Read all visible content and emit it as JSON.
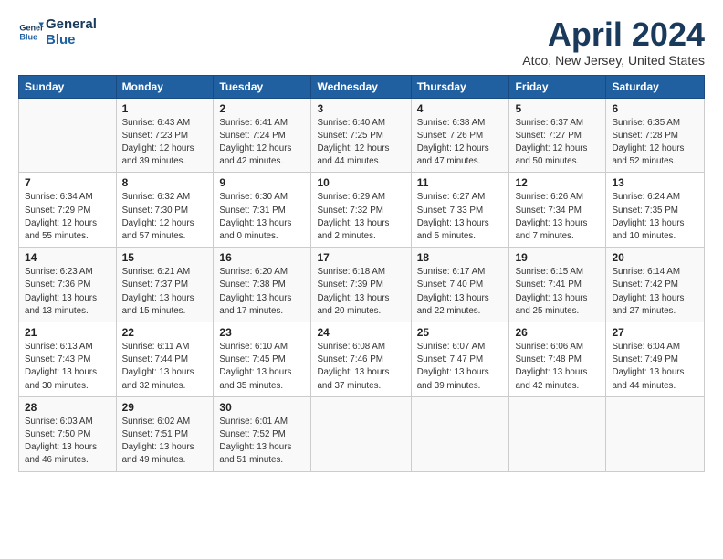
{
  "header": {
    "logo_line1": "General",
    "logo_line2": "Blue",
    "title": "April 2024",
    "subtitle": "Atco, New Jersey, United States"
  },
  "calendar": {
    "days_of_week": [
      "Sunday",
      "Monday",
      "Tuesday",
      "Wednesday",
      "Thursday",
      "Friday",
      "Saturday"
    ],
    "weeks": [
      [
        {
          "day": "",
          "info": ""
        },
        {
          "day": "1",
          "info": "Sunrise: 6:43 AM\nSunset: 7:23 PM\nDaylight: 12 hours\nand 39 minutes."
        },
        {
          "day": "2",
          "info": "Sunrise: 6:41 AM\nSunset: 7:24 PM\nDaylight: 12 hours\nand 42 minutes."
        },
        {
          "day": "3",
          "info": "Sunrise: 6:40 AM\nSunset: 7:25 PM\nDaylight: 12 hours\nand 44 minutes."
        },
        {
          "day": "4",
          "info": "Sunrise: 6:38 AM\nSunset: 7:26 PM\nDaylight: 12 hours\nand 47 minutes."
        },
        {
          "day": "5",
          "info": "Sunrise: 6:37 AM\nSunset: 7:27 PM\nDaylight: 12 hours\nand 50 minutes."
        },
        {
          "day": "6",
          "info": "Sunrise: 6:35 AM\nSunset: 7:28 PM\nDaylight: 12 hours\nand 52 minutes."
        }
      ],
      [
        {
          "day": "7",
          "info": "Sunrise: 6:34 AM\nSunset: 7:29 PM\nDaylight: 12 hours\nand 55 minutes."
        },
        {
          "day": "8",
          "info": "Sunrise: 6:32 AM\nSunset: 7:30 PM\nDaylight: 12 hours\nand 57 minutes."
        },
        {
          "day": "9",
          "info": "Sunrise: 6:30 AM\nSunset: 7:31 PM\nDaylight: 13 hours\nand 0 minutes."
        },
        {
          "day": "10",
          "info": "Sunrise: 6:29 AM\nSunset: 7:32 PM\nDaylight: 13 hours\nand 2 minutes."
        },
        {
          "day": "11",
          "info": "Sunrise: 6:27 AM\nSunset: 7:33 PM\nDaylight: 13 hours\nand 5 minutes."
        },
        {
          "day": "12",
          "info": "Sunrise: 6:26 AM\nSunset: 7:34 PM\nDaylight: 13 hours\nand 7 minutes."
        },
        {
          "day": "13",
          "info": "Sunrise: 6:24 AM\nSunset: 7:35 PM\nDaylight: 13 hours\nand 10 minutes."
        }
      ],
      [
        {
          "day": "14",
          "info": "Sunrise: 6:23 AM\nSunset: 7:36 PM\nDaylight: 13 hours\nand 13 minutes."
        },
        {
          "day": "15",
          "info": "Sunrise: 6:21 AM\nSunset: 7:37 PM\nDaylight: 13 hours\nand 15 minutes."
        },
        {
          "day": "16",
          "info": "Sunrise: 6:20 AM\nSunset: 7:38 PM\nDaylight: 13 hours\nand 17 minutes."
        },
        {
          "day": "17",
          "info": "Sunrise: 6:18 AM\nSunset: 7:39 PM\nDaylight: 13 hours\nand 20 minutes."
        },
        {
          "day": "18",
          "info": "Sunrise: 6:17 AM\nSunset: 7:40 PM\nDaylight: 13 hours\nand 22 minutes."
        },
        {
          "day": "19",
          "info": "Sunrise: 6:15 AM\nSunset: 7:41 PM\nDaylight: 13 hours\nand 25 minutes."
        },
        {
          "day": "20",
          "info": "Sunrise: 6:14 AM\nSunset: 7:42 PM\nDaylight: 13 hours\nand 27 minutes."
        }
      ],
      [
        {
          "day": "21",
          "info": "Sunrise: 6:13 AM\nSunset: 7:43 PM\nDaylight: 13 hours\nand 30 minutes."
        },
        {
          "day": "22",
          "info": "Sunrise: 6:11 AM\nSunset: 7:44 PM\nDaylight: 13 hours\nand 32 minutes."
        },
        {
          "day": "23",
          "info": "Sunrise: 6:10 AM\nSunset: 7:45 PM\nDaylight: 13 hours\nand 35 minutes."
        },
        {
          "day": "24",
          "info": "Sunrise: 6:08 AM\nSunset: 7:46 PM\nDaylight: 13 hours\nand 37 minutes."
        },
        {
          "day": "25",
          "info": "Sunrise: 6:07 AM\nSunset: 7:47 PM\nDaylight: 13 hours\nand 39 minutes."
        },
        {
          "day": "26",
          "info": "Sunrise: 6:06 AM\nSunset: 7:48 PM\nDaylight: 13 hours\nand 42 minutes."
        },
        {
          "day": "27",
          "info": "Sunrise: 6:04 AM\nSunset: 7:49 PM\nDaylight: 13 hours\nand 44 minutes."
        }
      ],
      [
        {
          "day": "28",
          "info": "Sunrise: 6:03 AM\nSunset: 7:50 PM\nDaylight: 13 hours\nand 46 minutes."
        },
        {
          "day": "29",
          "info": "Sunrise: 6:02 AM\nSunset: 7:51 PM\nDaylight: 13 hours\nand 49 minutes."
        },
        {
          "day": "30",
          "info": "Sunrise: 6:01 AM\nSunset: 7:52 PM\nDaylight: 13 hours\nand 51 minutes."
        },
        {
          "day": "",
          "info": ""
        },
        {
          "day": "",
          "info": ""
        },
        {
          "day": "",
          "info": ""
        },
        {
          "day": "",
          "info": ""
        }
      ]
    ]
  }
}
